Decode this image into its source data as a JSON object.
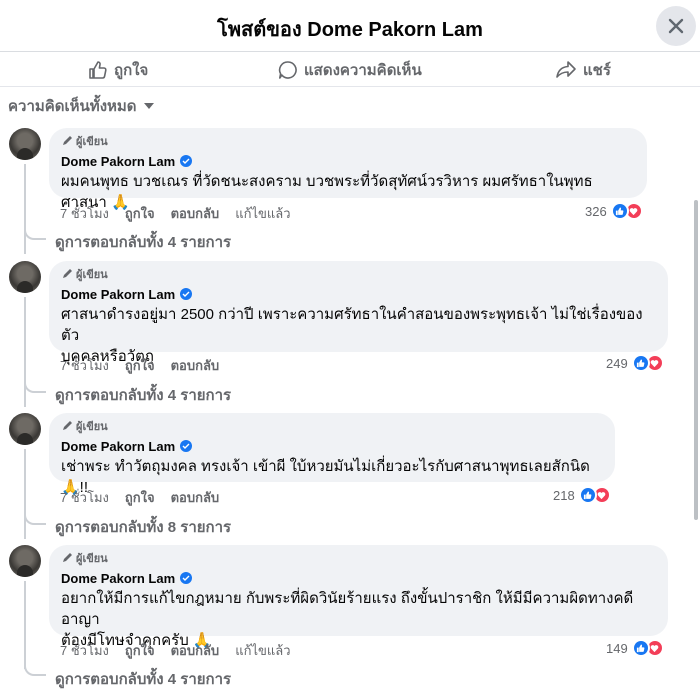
{
  "header": {
    "title": "โพสต์ของ Dome Pakorn Lam"
  },
  "actions": {
    "like": "ถูกใจ",
    "comment": "แสดงความคิดเห็น",
    "share": "แชร์"
  },
  "sort": {
    "label": "ความคิดเห็นทั้งหมด"
  },
  "colors": {
    "accent": "#1877f2",
    "love": "#f33e58",
    "bubble": "#f0f2f5",
    "muted": "#65676b"
  },
  "comments": [
    {
      "badge": "ผู้เขียน",
      "author": "Dome Pakorn Lam",
      "text": "ผมคนพุทธ บวชเณร ที่วัดชนะสงคราม บวชพระที่วัดสุทัศน์วรวิหาร ผมศรัทธาในพุทธศาสนา 🙏",
      "time": "7 ชั่วโมง",
      "like": "ถูกใจ",
      "reply": "ตอบกลับ",
      "edited": "แก้ไขแล้ว",
      "reaction_count": "326",
      "view_replies": "ดูการตอบกลับทั้ง 4 รายการ"
    },
    {
      "badge": "ผู้เขียน",
      "author": "Dome Pakorn Lam",
      "text_lines": [
        "ศาสนาดำรงอยู่มา 2500 กว่าปี เพราะความศรัทธาในคำสอนของพระพุทธเจ้า ไม่ใช่เรื่องของตัว",
        "บุคคลหรือวัตถุ"
      ],
      "time": "7 ชั่วโมง",
      "like": "ถูกใจ",
      "reply": "ตอบกลับ",
      "reaction_count": "249",
      "view_replies": "ดูการตอบกลับทั้ง 4 รายการ"
    },
    {
      "badge": "ผู้เขียน",
      "author": "Dome Pakorn Lam",
      "text": "เช่าพระ ทำวัตถุมงคล ทรงเจ้า เข้าผี ใบ้หวยมันไม่เกี่ยวอะไรกับศาสนาพุทธเลยสักนิด 🙏!!",
      "time": "7 ชั่วโมง",
      "like": "ถูกใจ",
      "reply": "ตอบกลับ",
      "reaction_count": "218",
      "view_replies": "ดูการตอบกลับทั้ง 8 รายการ"
    },
    {
      "badge": "ผู้เขียน",
      "author": "Dome Pakorn Lam",
      "text_lines": [
        "อยากให้มีการแก้ไขกฎหมาย กับพระที่ผิดวินัยร้ายแรง ถึงขั้นปาราชิก ให้มีมีความผิดทางคดีอาญา",
        "ต้องมีโทษจำคุกครับ 🙏"
      ],
      "time": "7 ชั่วโมง",
      "like": "ถูกใจ",
      "reply": "ตอบกลับ",
      "edited": "แก้ไขแล้ว",
      "reaction_count": "149",
      "view_replies": "ดูการตอบกลับทั้ง 4 รายการ"
    }
  ]
}
